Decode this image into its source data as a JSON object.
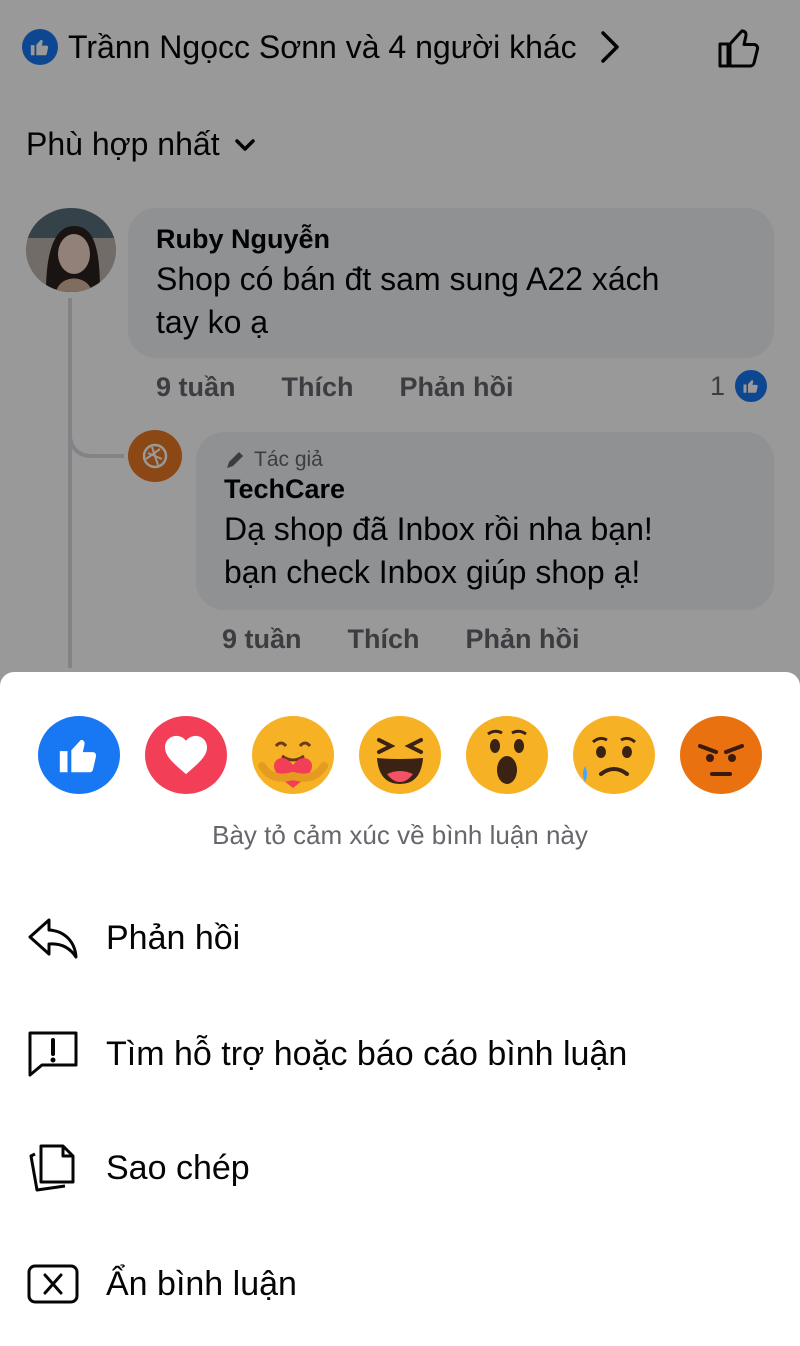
{
  "header": {
    "reactors_text": "Trầnn Ngọcc Sơnn và 4 người khác"
  },
  "sort": {
    "label": "Phù hợp nhất"
  },
  "comments": [
    {
      "author": "Ruby Nguyễn",
      "text_line1": "Shop có bán đt sam sung A22 xách",
      "text_line2": "tay ko ạ",
      "time": "9 tuần",
      "like_label": "Thích",
      "reply_label": "Phản hồi",
      "reaction_count": "1"
    },
    {
      "badge": "Tác giả",
      "author": "TechCare",
      "text_line1": "Dạ shop đã  Inbox rồi nha bạn!",
      "text_line2": "bạn check Inbox  giúp shop ạ!",
      "time": "9 tuần",
      "like_label": "Thích",
      "reply_label": "Phản hồi"
    }
  ],
  "sheet": {
    "reactions": [
      "like",
      "love",
      "care",
      "haha",
      "wow",
      "sad",
      "angry"
    ],
    "hint": "Bày tỏ cảm xúc về bình luận này",
    "menu": [
      {
        "label": "Phản hồi",
        "icon": "reply-icon"
      },
      {
        "label": "Tìm hỗ trợ hoặc báo cáo bình luận",
        "icon": "report-icon"
      },
      {
        "label": "Sao chép",
        "icon": "copy-icon"
      },
      {
        "label": "Ẩn bình luận",
        "icon": "hide-icon"
      }
    ]
  },
  "colors": {
    "brand_blue": "#1877f2",
    "love_red": "#f33e58",
    "reaction_yellow": "#f7b125",
    "angry_orange": "#e9710f",
    "overlay": "rgba(0,0,0,0.40)"
  }
}
